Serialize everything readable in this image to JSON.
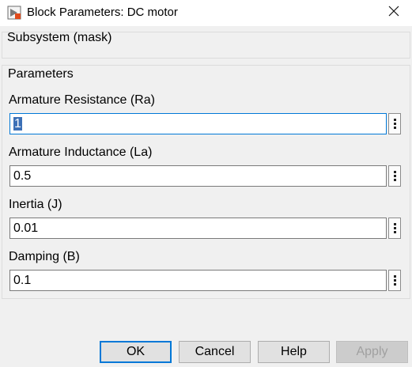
{
  "window": {
    "title": "Block Parameters: DC motor",
    "app_icon": "simulink-block-icon",
    "close_icon": "close-icon"
  },
  "mask": {
    "title": "Subsystem (mask)"
  },
  "parameters": {
    "title": "Parameters",
    "fields": [
      {
        "label": "Armature Resistance (Ra)",
        "value": "1"
      },
      {
        "label": "Armature Inductance (La)",
        "value": "0.5"
      },
      {
        "label": "Inertia (J)",
        "value": "0.01"
      },
      {
        "label": "Damping (B)",
        "value": "0.1"
      }
    ],
    "more_icon": "vertical-ellipsis-icon"
  },
  "buttons": {
    "ok": "OK",
    "cancel": "Cancel",
    "help": "Help",
    "apply": "Apply"
  },
  "colors": {
    "focus_accent": "#0078d7",
    "selection": "#3b6fb6",
    "dialog_bg": "#f0f0f0"
  }
}
